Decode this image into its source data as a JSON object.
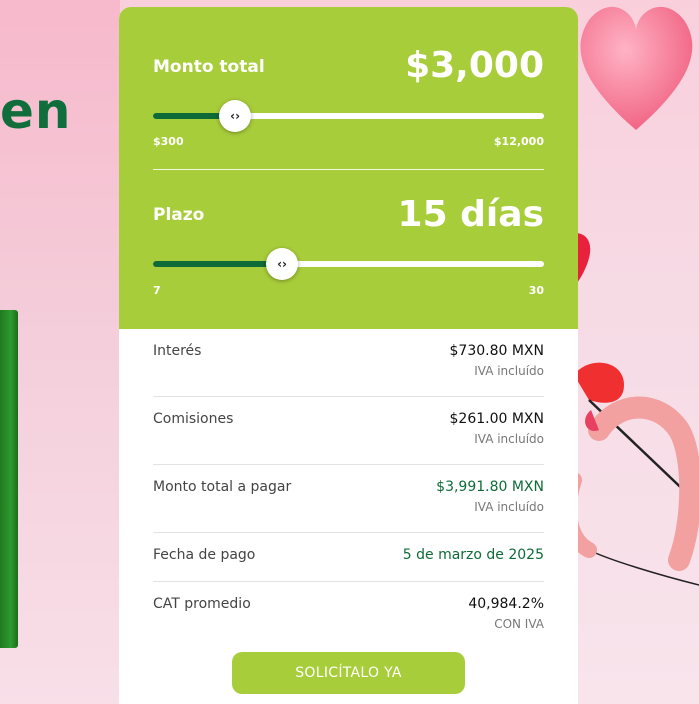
{
  "background": {
    "headline_fragment": "en"
  },
  "calculator": {
    "amount": {
      "label": "Monto total",
      "value": "$3,000",
      "min": "$300",
      "max": "$12,000",
      "slider_fraction": 0.21
    },
    "term": {
      "label": "Plazo",
      "value": "15 días",
      "min": "7",
      "max": "30",
      "slider_fraction": 0.33
    },
    "thumb_glyph": "‹›"
  },
  "summary": {
    "interest": {
      "label": "Interés",
      "value": "$730.80 MXN",
      "sub": "IVA incluído"
    },
    "fees": {
      "label": "Comisiones",
      "value": "$261.00 MXN",
      "sub": "IVA incluído"
    },
    "total": {
      "label": "Monto total a pagar",
      "value": "$3,991.80 MXN",
      "sub": "IVA incluído"
    },
    "due_date": {
      "label": "Fecha de pago",
      "value": "5 de marzo de 2025"
    },
    "cat": {
      "label": "CAT promedio",
      "value": "40,984.2%",
      "sub": "CON IVA"
    }
  },
  "cta": {
    "label": "SOLICÍTALO YA"
  },
  "colors": {
    "brand_lime": "#a8cd3a",
    "brand_green": "#0e6b37"
  },
  "icons": [
    "heart-icon",
    "slider-arrows-icon"
  ]
}
